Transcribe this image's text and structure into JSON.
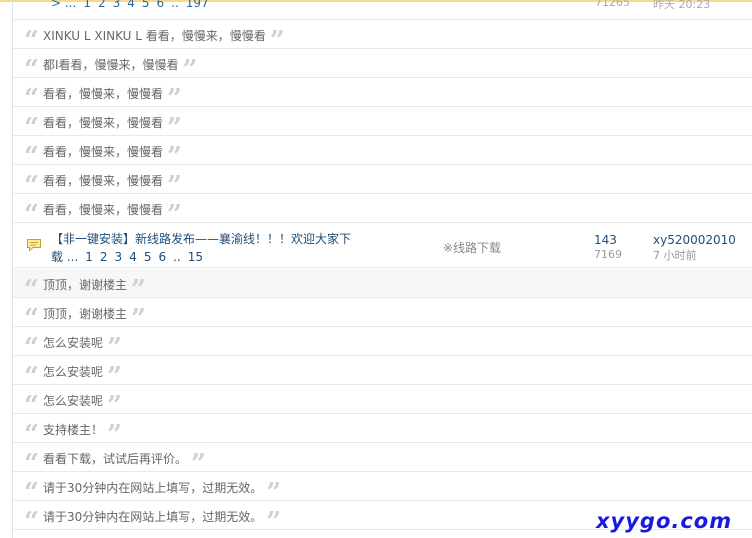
{
  "top_fragment": {
    "pager": [
      "> ...",
      "1",
      "2",
      "3",
      "4",
      "5",
      "6",
      "..",
      "197"
    ],
    "views": "71265",
    "time": "昨天 20:23"
  },
  "quotes_a": [
    "XINKU L XINKU L 看看，慢慢来，慢慢看",
    "都I看看，慢慢来，慢慢看",
    "看看，慢慢来，慢慢看",
    "看看，慢慢来，慢慢看",
    "看看，慢慢来，慢慢看",
    "看看，慢慢来，慢慢看",
    "看看，慢慢来，慢慢看"
  ],
  "thread": {
    "title": "【非一键安装】新线路发布——襄渝线！！！欢迎大家下载",
    "title_line1": "【非一键安装】新线路发布——襄渝线！！！欢迎大家下",
    "title_line2": "载 ...",
    "pager": [
      "1",
      "2",
      "3",
      "4",
      "5",
      "6",
      "..",
      "15"
    ],
    "tag": "※线路下载",
    "replies": "143",
    "views": "7169",
    "author": "xy520002010",
    "time": "7 小时前",
    "icon": "comment-icon"
  },
  "quotes_b": [
    "顶顶，谢谢楼主",
    "顶顶，谢谢楼主",
    "怎么安装呢",
    "怎么安装呢",
    "怎么安装呢",
    "支持楼主！",
    "看看下载，试试后再评价。",
    "请于30分钟内在网站上填写，过期无效。",
    "请于30分钟内在网站上填写，过期无效。"
  ],
  "quote_open": "“",
  "quote_close": "”",
  "watermark": "xyygo.com",
  "colors": {
    "link": "#1f4e79",
    "quote_mark": "#d0d0d0",
    "watermark": "#1a1adf"
  }
}
